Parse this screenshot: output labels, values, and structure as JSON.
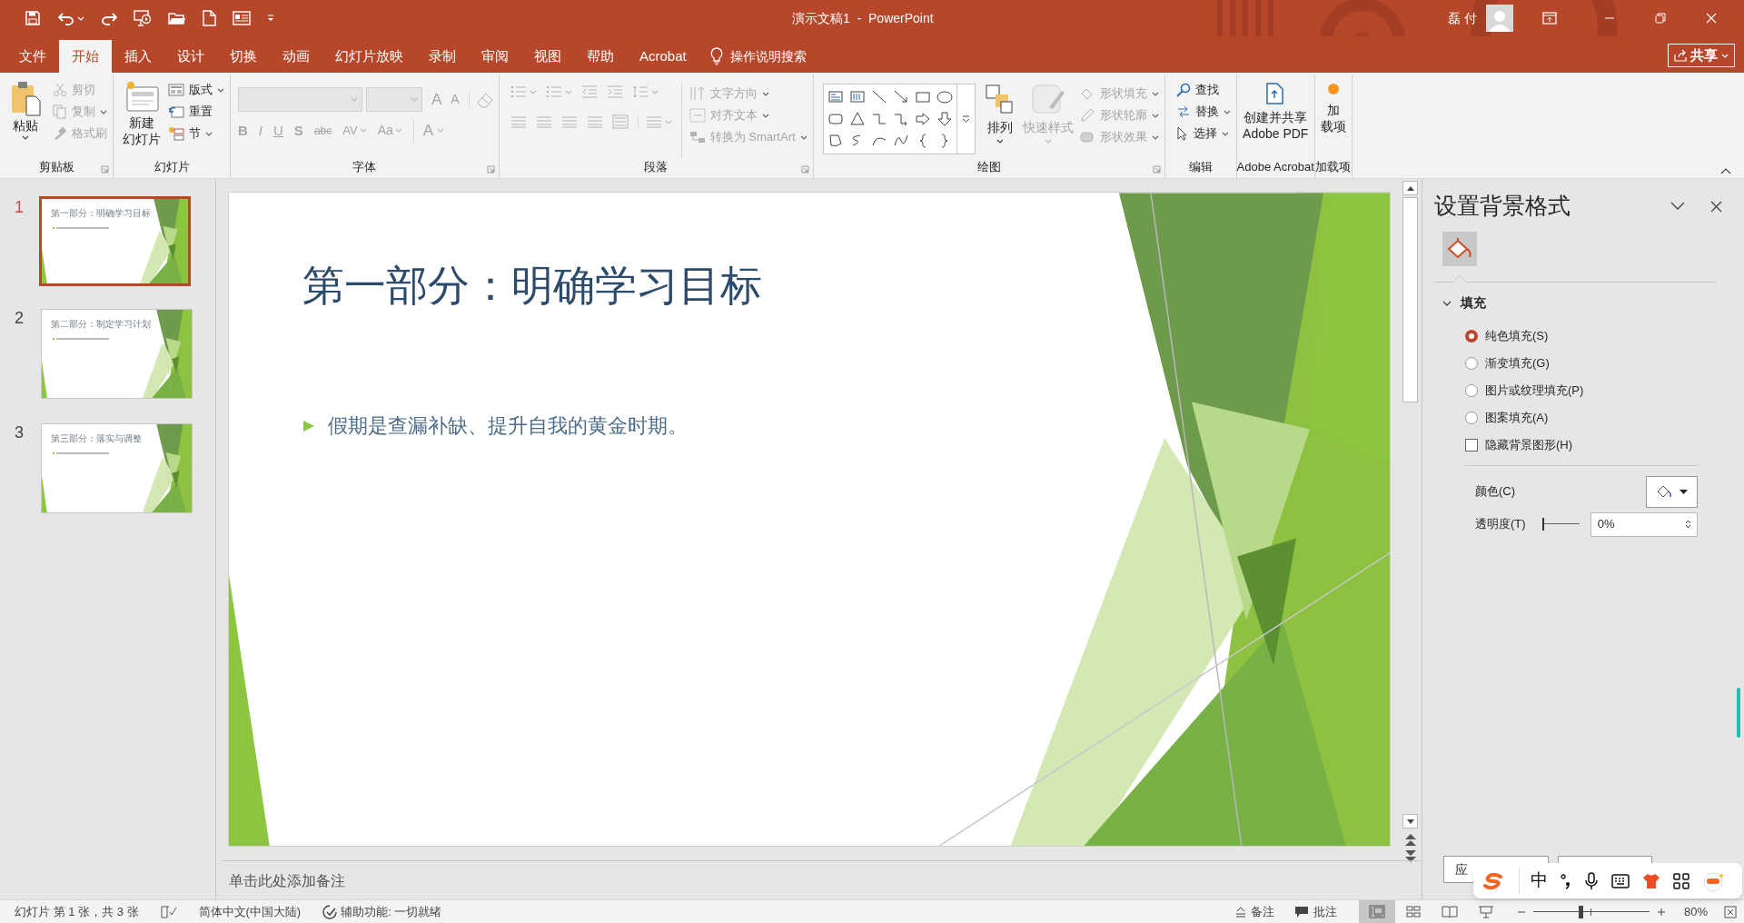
{
  "window": {
    "title": "演示文稿1  -  PowerPoint",
    "user": "磊 付"
  },
  "menu_tabs": [
    {
      "label": "文件",
      "selected": false
    },
    {
      "label": "开始",
      "selected": true
    },
    {
      "label": "插入",
      "selected": false
    },
    {
      "label": "设计",
      "selected": false
    },
    {
      "label": "切换",
      "selected": false
    },
    {
      "label": "动画",
      "selected": false
    },
    {
      "label": "幻灯片放映",
      "selected": false
    },
    {
      "label": "录制",
      "selected": false
    },
    {
      "label": "审阅",
      "selected": false
    },
    {
      "label": "视图",
      "selected": false
    },
    {
      "label": "帮助",
      "selected": false
    },
    {
      "label": "Acrobat",
      "selected": false
    }
  ],
  "tell_me": {
    "placeholder": "操作说明搜索"
  },
  "share_button": "共享",
  "ribbon": {
    "clipboard": {
      "label": "剪贴板",
      "paste": "粘贴",
      "cut": {
        "label": "剪切",
        "disabled": true
      },
      "copy": {
        "label": "复制",
        "disabled": true
      },
      "format_painter": {
        "label": "格式刷",
        "disabled": true
      }
    },
    "slides": {
      "label": "幻灯片",
      "new_slide": [
        "新建",
        "幻灯片"
      ],
      "layout": "版式",
      "reset": "重置",
      "section": "节"
    },
    "font": {
      "label": "字体",
      "disabled": true,
      "grow": "A",
      "shrink": "A",
      "buttons": [
        "B",
        "I",
        "U",
        "S",
        "abc",
        "AV",
        "Aa"
      ],
      "color_button": "A"
    },
    "paragraph": {
      "label": "段落",
      "disabled": true,
      "text_direction": "文字方向",
      "align_text": "对齐文本",
      "smartart": "转换为 SmartArt"
    },
    "drawing": {
      "label": "绘图",
      "arrange": "排列",
      "quick_styles": {
        "label": "快速样式",
        "disabled": true
      },
      "shape_fill": {
        "label": "形状填充",
        "disabled": true
      },
      "shape_outline": {
        "label": "形状轮廓",
        "disabled": true
      },
      "shape_effects": {
        "label": "形状效果",
        "disabled": true
      }
    },
    "editing": {
      "label": "编辑",
      "find": "查找",
      "replace": "替换",
      "select": "选择"
    },
    "acrobat": {
      "label": "Adobe Acrobat",
      "create": [
        "创建并共享",
        "Adobe PDF"
      ]
    },
    "addins": {
      "label": "加载项",
      "button": [
        "加",
        "载项"
      ]
    }
  },
  "thumbnails": [
    {
      "number": "1",
      "title": "第一部分：明确学习目标",
      "selected": true
    },
    {
      "number": "2",
      "title": "第二部分：制定学习计划",
      "selected": false
    },
    {
      "number": "3",
      "title": "第三部分：落实与调整",
      "selected": false
    }
  ],
  "slide": {
    "title": "第一部分：明确学习目标",
    "bullets": [
      "假期是查漏补缺、提升自我的黄金时期。"
    ]
  },
  "notes": {
    "placeholder": "单击此处添加备注"
  },
  "format_pane": {
    "title": "设置背景格式",
    "section": {
      "label": "填充",
      "expanded": true
    },
    "fill_options": [
      {
        "label": "纯色填充(S)",
        "selected": true
      },
      {
        "label": "渐变填充(G)",
        "selected": false
      },
      {
        "label": "图片或纹理填充(P)",
        "selected": false
      },
      {
        "label": "图案填充(A)",
        "selected": false
      }
    ],
    "hide_background": {
      "label": "隐藏背景图形(H)",
      "checked": false
    },
    "color": {
      "label": "颜色(C)"
    },
    "transparency": {
      "label": "透明度(T)",
      "level": 0,
      "value": "0%"
    },
    "apply_button": "应"
  },
  "status_bar": {
    "slide_info": "幻灯片 第 1 张，共 3 张",
    "language": "简体中文(中国大陆)",
    "accessibility": "辅助功能: 一切就绪",
    "notes": "备注",
    "comments": "批注",
    "views": [
      {
        "selected": true
      },
      {
        "selected": false
      },
      {
        "selected": false
      },
      {
        "selected": false
      }
    ],
    "zoom": {
      "level": 0.41,
      "value": "80%"
    }
  },
  "ime_toolbar": {
    "mode": "中"
  }
}
